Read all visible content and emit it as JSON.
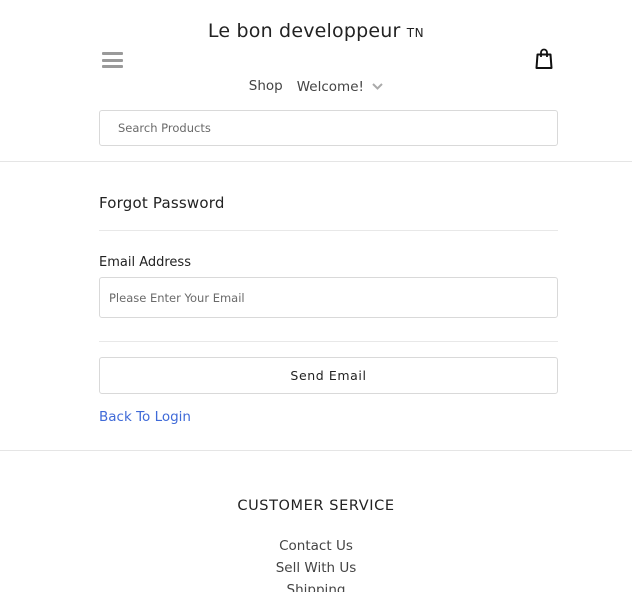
{
  "header": {
    "brand": "Le bon developpeur",
    "brand_suffix": "TN",
    "menu_icon": "hamburger-menu-icon",
    "cart_icon": "shopping-bag-icon"
  },
  "nav": {
    "shop": "Shop",
    "welcome": "Welcome!"
  },
  "search": {
    "placeholder": "Search Products"
  },
  "forgot_password": {
    "title": "Forgot Password",
    "email_label": "Email Address",
    "email_placeholder": "Please Enter Your Email",
    "send_button": "Send Email",
    "back_link": "Back To Login"
  },
  "footer": {
    "title": "CUSTOMER SERVICE",
    "links": [
      "Contact Us",
      "Sell With Us",
      "Shipping"
    ]
  },
  "colors": {
    "link": "#3f6ad8",
    "border": "#d9d9d9",
    "icon_gray": "#9a9a9a"
  }
}
